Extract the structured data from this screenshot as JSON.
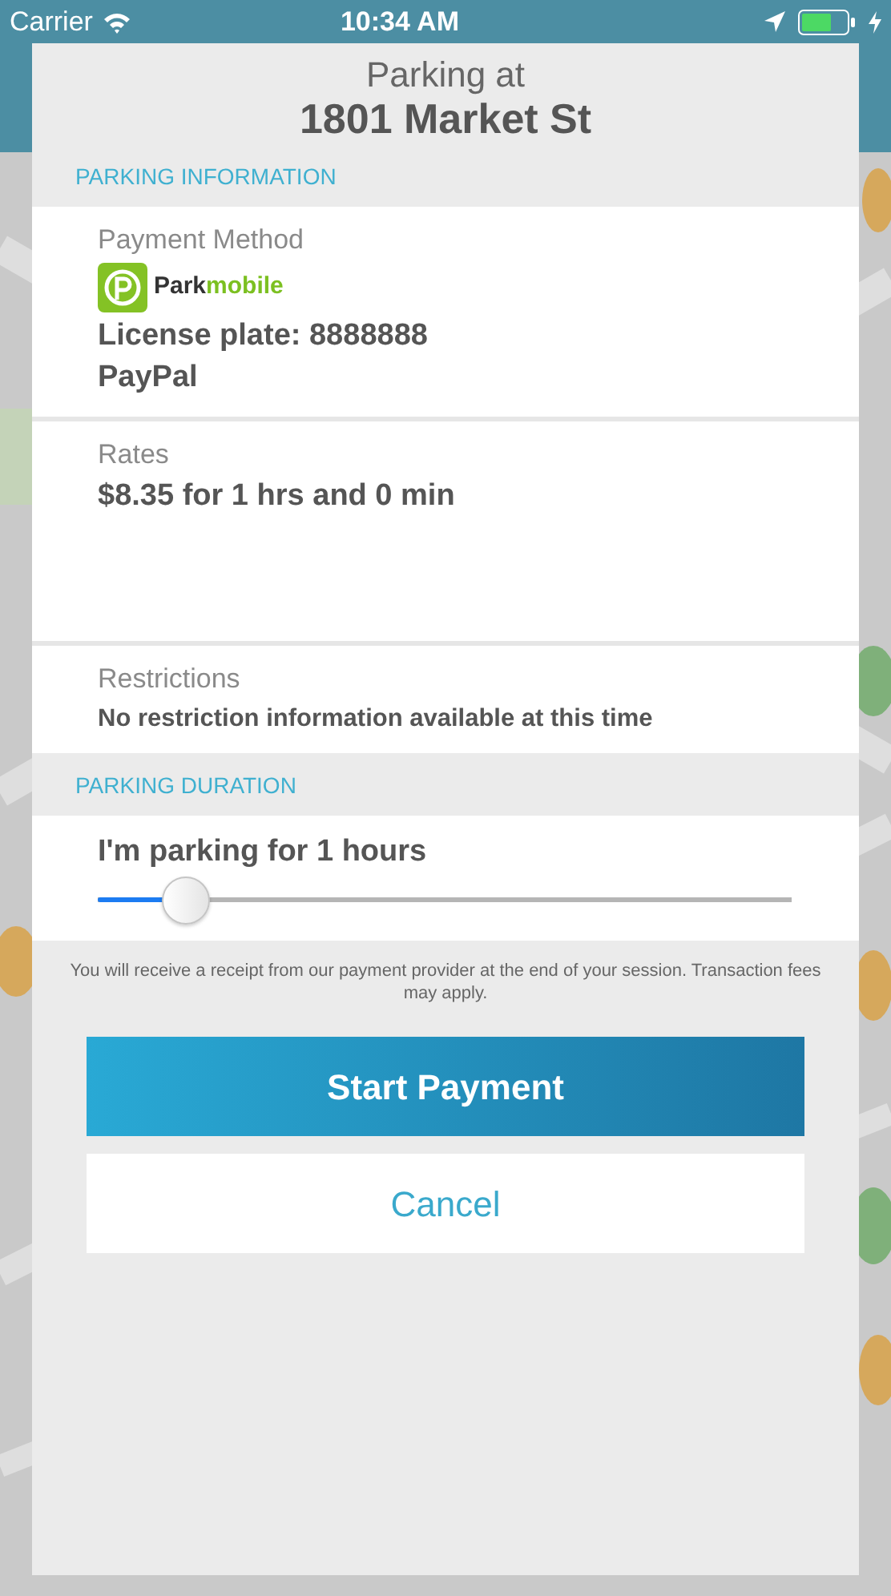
{
  "status_bar": {
    "carrier": "Carrier",
    "time": "10:34 AM"
  },
  "modal": {
    "title": "Parking at",
    "address": "1801 Market St"
  },
  "parking_information": {
    "heading": "PARKING INFORMATION",
    "payment": {
      "label": "Payment Method",
      "logo_text": [
        "Park",
        "mobile"
      ],
      "license_plate": "License plate: 8888888",
      "method": "PayPal"
    },
    "rates": {
      "label": "Rates",
      "value": "$8.35 for 1 hrs and 0 min"
    },
    "restrictions": {
      "label": "Restrictions",
      "value": "No restriction information available at this time"
    }
  },
  "parking_duration": {
    "heading": "PARKING DURATION",
    "label": "I'm parking for 1 hours",
    "level": 0.1
  },
  "note": "You will receive a receipt from our payment provider at the end of your session. Transaction fees may apply.",
  "buttons": [
    {
      "label": "Start Payment",
      "kind": "primary"
    },
    {
      "label": "Cancel",
      "kind": "secondary"
    }
  ]
}
